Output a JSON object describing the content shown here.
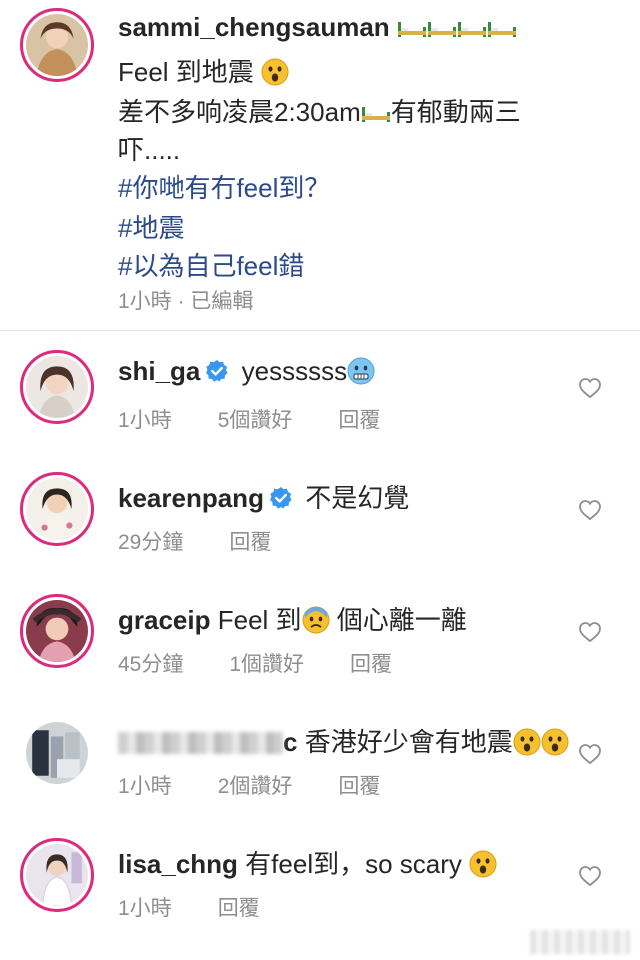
{
  "post": {
    "username": "sammi_chengsauman",
    "line1_text": "Feel 到地震",
    "line2_text": "差不多响凌晨2:30am",
    "line2_suffix": "有郁動兩三",
    "line3_text": "吓.....",
    "hashtags": [
      "#你哋有冇feel到？",
      "#地震",
      "#以為自己feel錯"
    ],
    "meta": "1小時 · 已編輯"
  },
  "comments": [
    {
      "username": "shi_ga",
      "verified": true,
      "text": "yessssss",
      "emoji": "cold-face-emoji",
      "time": "1小時",
      "likes": "5個讚好",
      "reply": "回覆"
    },
    {
      "username": "kearenpang",
      "verified": true,
      "text": "不是幻覺",
      "time": "29分鐘",
      "reply": "回覆"
    },
    {
      "username": "graceip",
      "verified": false,
      "text_before": "Feel 到",
      "text_after": " 個心離一離",
      "emoji": "anxious-face-emoji",
      "time": "45分鐘",
      "likes": "1個讚好",
      "reply": "回覆"
    },
    {
      "username_suffix": "c",
      "verified": false,
      "text": "香港好少會有地震",
      "emoji": "surprised-face-emoji",
      "time": "1小時",
      "likes": "2個讚好",
      "reply": "回覆"
    },
    {
      "username": "lisa_chng",
      "verified": false,
      "text": "有feel到，so scary",
      "emoji": "surprised-face-emoji",
      "time": "1小時",
      "reply": "回覆"
    }
  ],
  "colors": {
    "ring": "#dd2a7b",
    "hashtag": "#2b4a8c",
    "verified": "#3897f0",
    "meta": "#8e8e8e"
  }
}
